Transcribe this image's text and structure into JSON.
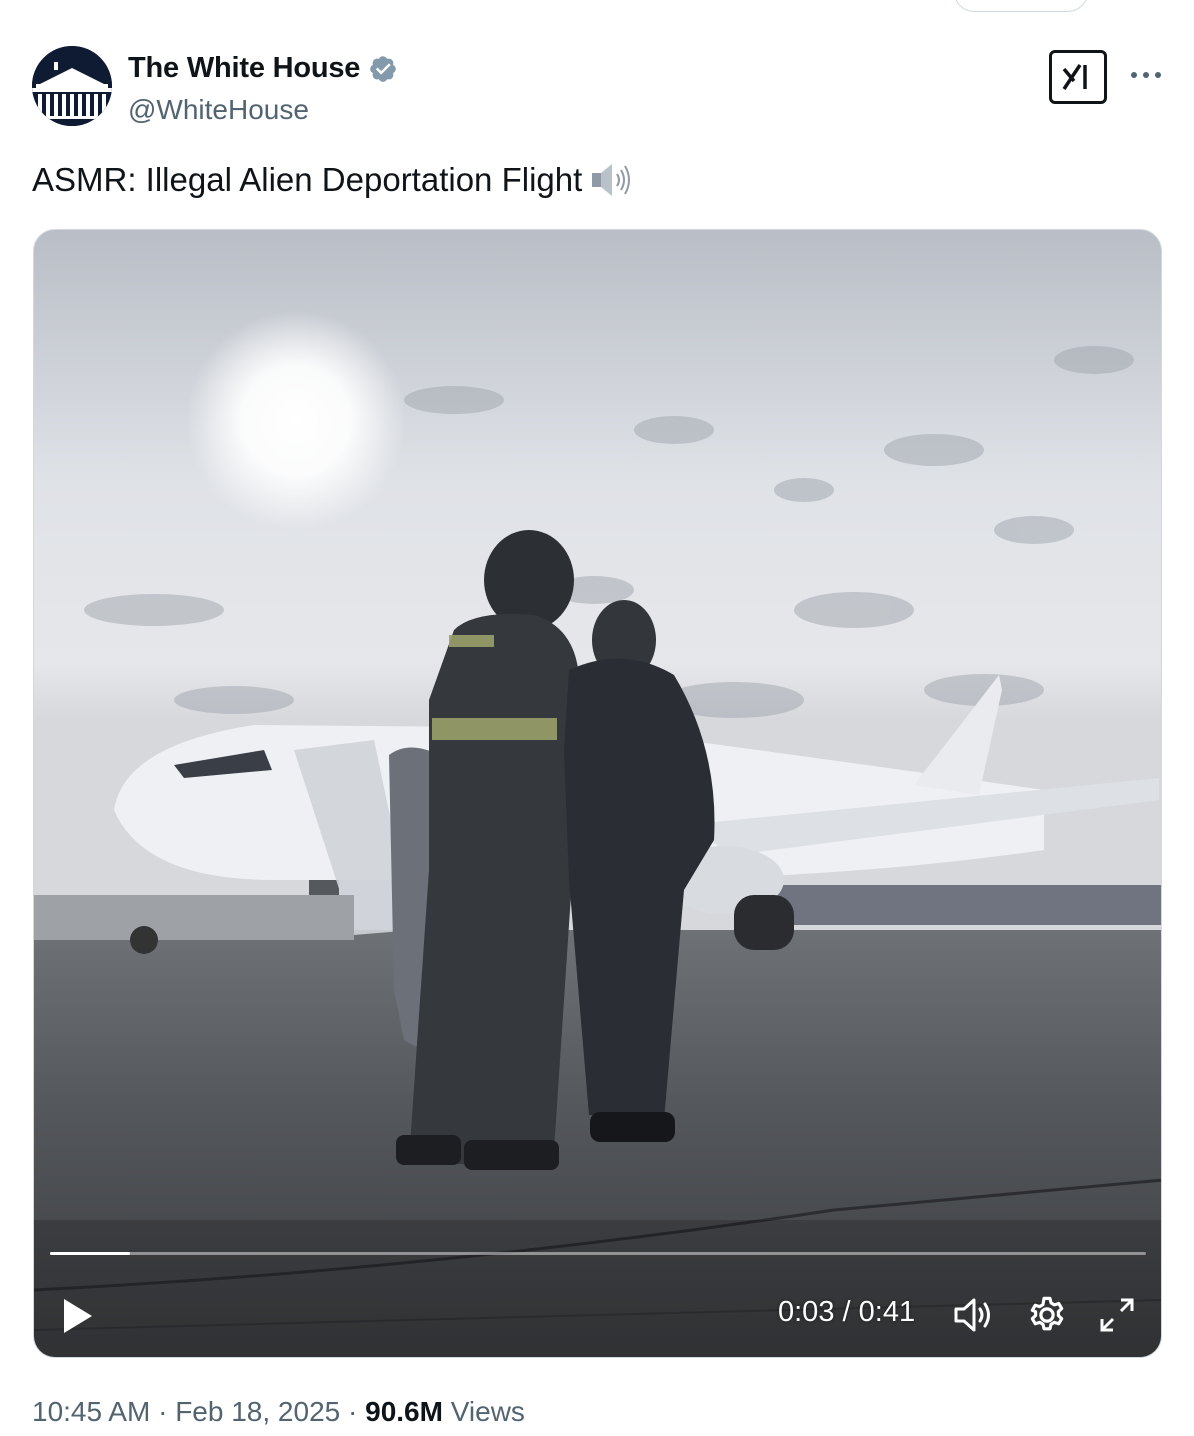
{
  "author": {
    "display_name": "The White House",
    "handle": "@WhiteHouse",
    "verified": true,
    "verified_color": "#829aab"
  },
  "tweet": {
    "text": "ASMR: Illegal Alien Deportation Flight",
    "emoji": "speaker-high-volume-icon"
  },
  "video": {
    "elapsed": "0:03",
    "separator": "/",
    "duration": "0:41",
    "progress_fraction": 0.073
  },
  "meta": {
    "time": "10:45 AM",
    "dot": "·",
    "date": "Feb 18, 2025",
    "views_count": "90.6M",
    "views_label": "Views"
  },
  "colors": {
    "text_primary": "#0f1419",
    "text_secondary": "#536471",
    "border": "#cfd9de"
  }
}
